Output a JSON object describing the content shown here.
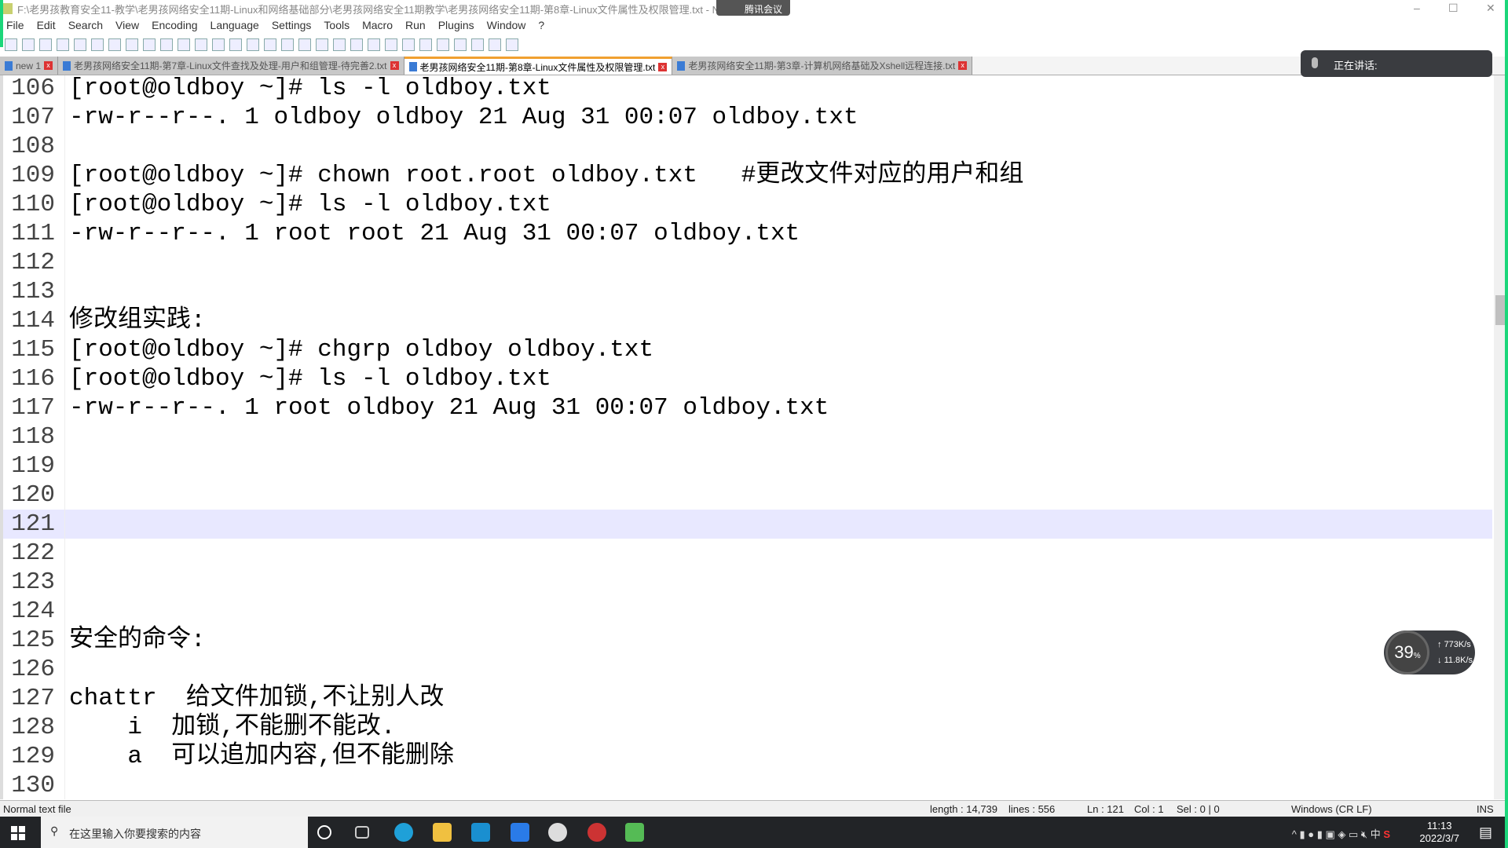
{
  "window": {
    "title": "F:\\老男孩教育安全11-教学\\老男孩网络安全11期-Linux和网络基础部分\\老男孩网络安全11期教学\\老男孩网络安全11期-第8章-Linux文件属性及权限管理.txt - Notepad++",
    "overlay_label": "腾讯会议"
  },
  "menu": [
    "File",
    "Edit",
    "Search",
    "View",
    "Encoding",
    "Language",
    "Settings",
    "Tools",
    "Macro",
    "Run",
    "Plugins",
    "Window",
    "?"
  ],
  "tabs": [
    {
      "label": "new 1"
    },
    {
      "label": "老男孩网络安全11期-第7章-Linux文件查找及处理-用户和组管理-待完善2.txt"
    },
    {
      "label": "老男孩网络安全11期-第8章-Linux文件属性及权限管理.txt",
      "active": true
    },
    {
      "label": "老男孩网络安全11期-第3章-计算机网络基础及Xshell远程连接.txt"
    }
  ],
  "meeting": {
    "speaking_label": "正在讲话:"
  },
  "editor": {
    "current_line": 121,
    "lines": [
      {
        "n": "106",
        "t": "[root@oldboy ~]# ls -l oldboy.txt"
      },
      {
        "n": "107",
        "t": "-rw-r--r--. 1 oldboy oldboy 21 Aug 31 00:07 oldboy.txt"
      },
      {
        "n": "108",
        "t": ""
      },
      {
        "n": "109",
        "t": "[root@oldboy ~]# chown root.root oldboy.txt   #更改文件对应的用户和组"
      },
      {
        "n": "110",
        "t": "[root@oldboy ~]# ls -l oldboy.txt"
      },
      {
        "n": "111",
        "t": "-rw-r--r--. 1 root root 21 Aug 31 00:07 oldboy.txt"
      },
      {
        "n": "112",
        "t": ""
      },
      {
        "n": "113",
        "t": ""
      },
      {
        "n": "114",
        "t": "修改组实践:"
      },
      {
        "n": "115",
        "t": "[root@oldboy ~]# chgrp oldboy oldboy.txt"
      },
      {
        "n": "116",
        "t": "[root@oldboy ~]# ls -l oldboy.txt"
      },
      {
        "n": "117",
        "t": "-rw-r--r--. 1 root oldboy 21 Aug 31 00:07 oldboy.txt"
      },
      {
        "n": "118",
        "t": ""
      },
      {
        "n": "119",
        "t": ""
      },
      {
        "n": "120",
        "t": ""
      },
      {
        "n": "121",
        "t": ""
      },
      {
        "n": "122",
        "t": ""
      },
      {
        "n": "123",
        "t": ""
      },
      {
        "n": "124",
        "t": ""
      },
      {
        "n": "125",
        "t": "安全的命令:"
      },
      {
        "n": "126",
        "t": ""
      },
      {
        "n": "127",
        "t": "chattr  给文件加锁,不让别人改"
      },
      {
        "n": "128",
        "t": "    i  加锁,不能删不能改."
      },
      {
        "n": "129",
        "t": "    a  可以追加内容,但不能删除"
      },
      {
        "n": "130",
        "t": ""
      }
    ]
  },
  "status": {
    "file_type": "Normal text file",
    "length": "length : 14,739",
    "lines": "lines : 556",
    "ln": "Ln : 121",
    "col": "Col : 1",
    "sel": "Sel : 0 | 0",
    "eol": "Windows (CR LF)",
    "mode": "INS"
  },
  "network": {
    "cpu": "39",
    "unit": "%",
    "up": "773K/s",
    "down": "11.8K/s"
  },
  "taskbar": {
    "search_placeholder": "在这里输入你要搜索的内容",
    "time": "11:13",
    "date": "2022/3/7",
    "ime": "中"
  }
}
